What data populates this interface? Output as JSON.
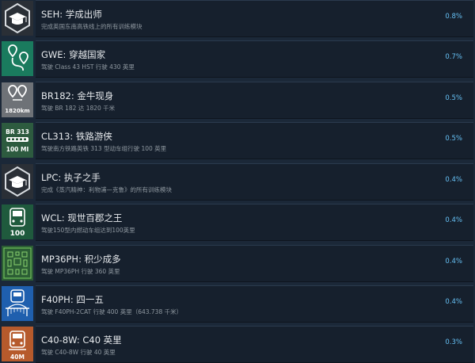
{
  "achievements": [
    {
      "title": "SEH: 学成出师",
      "description": "完成英国东南高铁线上的所有训练模块",
      "percent": "0.8%",
      "icon": "graduation-cap-icon"
    },
    {
      "title": "GWE: 穿越国家",
      "description": "驾驶 Class 43 HST 行驶 430 英里",
      "percent": "0.7%",
      "icon": "map-route-pins-icon"
    },
    {
      "title": "BR182: 金牛现身",
      "description": "驾驶 BR 182 达 1820 千米",
      "percent": "0.5%",
      "icon": "distance-pin-icon",
      "icon_text": "1820km"
    },
    {
      "title": "CL313: 铁路游侠",
      "description": "驾驶南方铁路英铁 313 型动车组行驶 100 英里",
      "percent": "0.5%",
      "icon": "train-mileage-icon",
      "icon_text_top": "BR 313",
      "icon_text_bottom": "100 MI"
    },
    {
      "title": "LPC: 执子之手",
      "description": "完成《蒸汽精神：利物浦—克鲁》的所有训练模块",
      "percent": "0.4%",
      "icon": "graduation-cap-icon"
    },
    {
      "title": "WCL: 现世百郡之王",
      "description": "驾驶150型内燃动车组达到100英里",
      "percent": "0.4%",
      "icon": "train-front-icon",
      "icon_text": "100"
    },
    {
      "title": "MP36PH: 积少成多",
      "description": "驾驶 MP36PH 行驶 360 英里",
      "percent": "0.4%",
      "icon": "pixel-pattern-icon"
    },
    {
      "title": "F40PH: 四一五",
      "description": "驾驶 F40PH-2CAT 行驶 400 英里（643.738 千米）",
      "percent": "0.4%",
      "icon": "bridge-train-icon"
    },
    {
      "title": "C40-8W: C40 英里",
      "description": "驾驶 C40-8W 行驶 40 英里",
      "percent": "0.3%",
      "icon": "locomotive-icon",
      "icon_text": "40M"
    }
  ]
}
